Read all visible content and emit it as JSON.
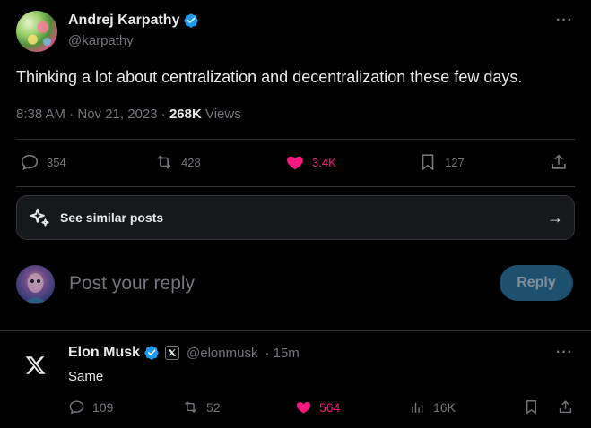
{
  "tweet": {
    "author_name": "Andrej Karpathy",
    "author_handle": "@karpathy",
    "more_label": "···",
    "text": "Thinking a lot about centralization and decentralization these few days.",
    "time": "8:38 AM · Nov 21, 2023 · ",
    "views_count": "268K",
    "views_label": " Views",
    "actions": {
      "replies": "354",
      "reposts": "428",
      "likes": "3.4K",
      "bookmarks": "127"
    }
  },
  "similar_posts": {
    "label": "See similar posts",
    "arrow": "→"
  },
  "compose": {
    "placeholder": "Post your reply",
    "reply_button": "Reply"
  },
  "reply": {
    "author_name": "Elon Musk",
    "author_handle": "@elonmusk",
    "age": "· 15m",
    "more_label": "···",
    "text": "Same",
    "actions": {
      "replies": "109",
      "reposts": "52",
      "likes": "564",
      "views": "16K"
    }
  },
  "colors": {
    "accent": "#1d9bf0",
    "like": "#f91880",
    "muted": "#71767b",
    "bg": "#000000"
  }
}
